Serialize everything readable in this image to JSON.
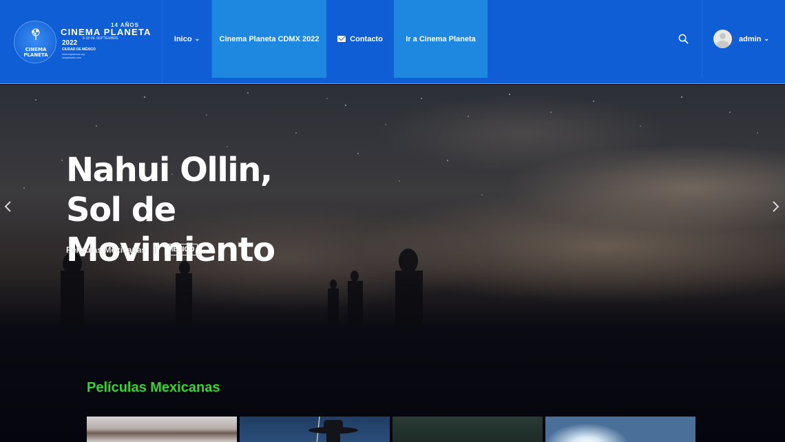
{
  "header": {
    "logo": {
      "badge_line1": "CINEMA",
      "badge_line2": "PLANETA",
      "anniversary": "14 AÑOS",
      "title": "CINEMA PLANETA",
      "dates": "8-18 DE SEPTIEMBRE",
      "year": "2022",
      "city": "CIUDAD DE MÉXICO",
      "url1": "cinemaplaneta.org",
      "url2": "vesplaneta.com"
    },
    "nav": {
      "inicio": "Inico",
      "cdmx": "Cinema Planeta CDMX 2022",
      "contacto": "Contacto",
      "ir": "Ir a Cinema Planeta"
    },
    "user": {
      "name": "admin"
    },
    "colors": {
      "bar": "#0f5ed6",
      "active": "#1e88e0"
    }
  },
  "hero": {
    "title": "Nahui Ollin, Sol de Movimiento",
    "category": "Películas Mexicanas",
    "tag": "MÉXICO"
  },
  "section": {
    "title": "Películas Mexicanas",
    "accent": "#36d62f"
  }
}
